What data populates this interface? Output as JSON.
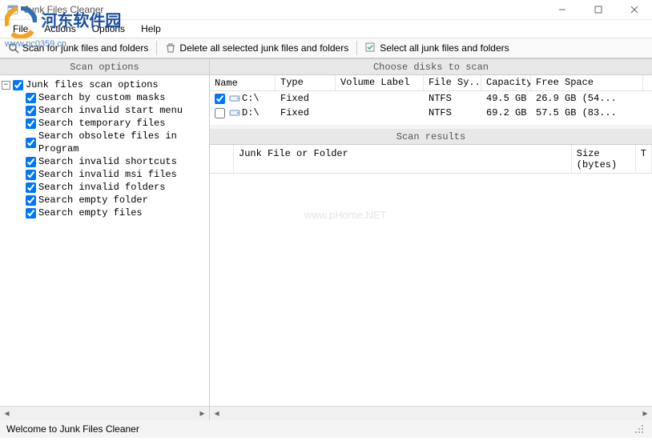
{
  "window": {
    "title": "Junk Files Cleaner"
  },
  "menubar": {
    "items": [
      "File",
      "Actions",
      "Options",
      "Help"
    ]
  },
  "toolbar": {
    "scan": "Scan for junk files and folders",
    "delete": "Delete all selected junk files and folders",
    "select_all": "Select all junk files and folders"
  },
  "panes": {
    "scan_options": "Scan options",
    "choose_disks": "Choose disks to scan",
    "scan_results": "Scan results"
  },
  "scan_tree": {
    "root": "Junk files scan options",
    "items": [
      "Search by custom masks",
      "Search invalid start menu",
      "Search temporary files",
      "Search obsolete files in Program",
      "Search invalid shortcuts",
      "Search invalid msi files",
      "Search invalid folders",
      "Search empty folder",
      "Search empty files"
    ]
  },
  "disks": {
    "columns": {
      "name": "Name",
      "type": "Type",
      "volume": "Volume Label",
      "fs": "File Sy...",
      "capacity": "Capacity",
      "free": "Free Space"
    },
    "rows": [
      {
        "checked": true,
        "name": "C:\\",
        "type": "Fixed",
        "volume": "",
        "fs": "NTFS",
        "capacity": "49.5 GB",
        "free": "26.9 GB (54..."
      },
      {
        "checked": false,
        "name": "D:\\",
        "type": "Fixed",
        "volume": "",
        "fs": "NTFS",
        "capacity": "69.2 GB",
        "free": "57.5 GB (83..."
      }
    ]
  },
  "results": {
    "columns": {
      "file": "Junk File or Folder",
      "size": "Size",
      "size2": "(bytes)",
      "t": "T"
    }
  },
  "statusbar": {
    "text": "Welcome to Junk Files Cleaner"
  },
  "watermark": {
    "brand": "河东软件园",
    "url": "www.pc0359.cn",
    "center": "www.pHome.NET"
  }
}
